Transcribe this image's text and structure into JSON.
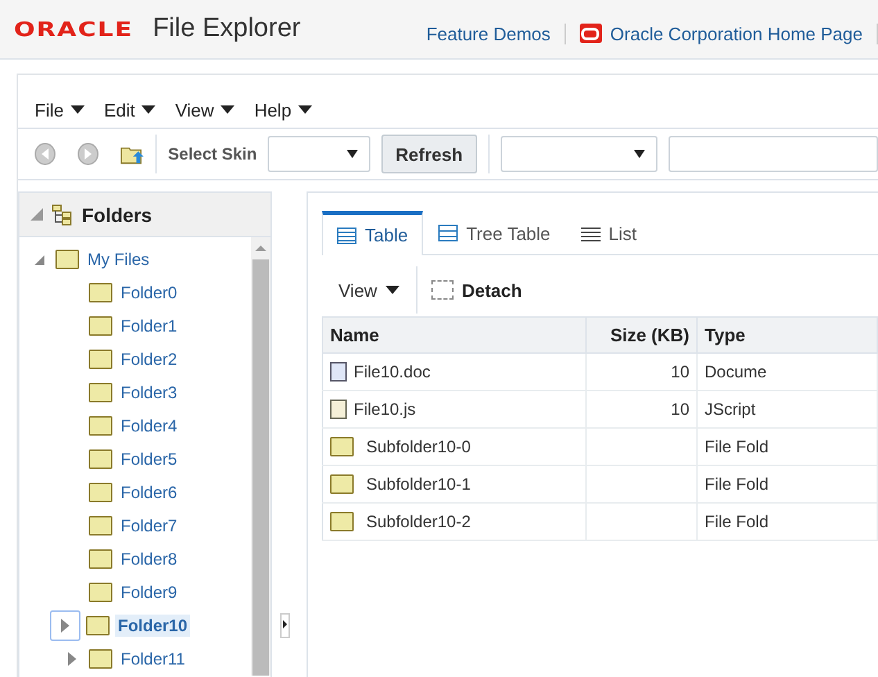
{
  "header": {
    "logo": "ORACLE",
    "title": "File Explorer",
    "links": [
      {
        "label": "Feature Demos",
        "icon": false
      },
      {
        "label": "Oracle Corporation Home Page",
        "icon": true
      }
    ]
  },
  "menus": [
    {
      "label": "File"
    },
    {
      "label": "Edit"
    },
    {
      "label": "View"
    },
    {
      "label": "Help"
    }
  ],
  "toolbar": {
    "skin_label": "Select Skin",
    "refresh": "Refresh"
  },
  "folders": {
    "title": "Folders",
    "expanded": true,
    "tree": [
      {
        "label": "My Files",
        "kind": "branch",
        "expanded": true,
        "selected": false,
        "children": [
          {
            "label": "Folder0",
            "kind": "leaf",
            "selected": false
          },
          {
            "label": "Folder1",
            "kind": "leaf",
            "selected": false
          },
          {
            "label": "Folder2",
            "kind": "leaf",
            "selected": false
          },
          {
            "label": "Folder3",
            "kind": "leaf",
            "selected": false
          },
          {
            "label": "Folder4",
            "kind": "leaf",
            "selected": false
          },
          {
            "label": "Folder5",
            "kind": "leaf",
            "selected": false
          },
          {
            "label": "Folder6",
            "kind": "leaf",
            "selected": false
          },
          {
            "label": "Folder7",
            "kind": "leaf",
            "selected": false
          },
          {
            "label": "Folder8",
            "kind": "leaf",
            "selected": false
          },
          {
            "label": "Folder9",
            "kind": "leaf",
            "selected": false
          },
          {
            "label": "Folder10",
            "kind": "branch",
            "expanded": false,
            "selected": true
          },
          {
            "label": "Folder11",
            "kind": "branch",
            "expanded": false,
            "selected": false
          }
        ]
      }
    ]
  },
  "tabs": [
    {
      "label": "Table",
      "kind": "table",
      "selected": true
    },
    {
      "label": "Tree Table",
      "kind": "treetable",
      "selected": false
    },
    {
      "label": "List",
      "kind": "list",
      "selected": false
    }
  ],
  "view_menu": "View",
  "detach": "Detach",
  "table": {
    "columns": [
      "Name",
      "Size (KB)",
      "Type"
    ],
    "rows": [
      {
        "kind": "doc",
        "name": "File10.doc",
        "size": "10",
        "type": "Docume"
      },
      {
        "kind": "script",
        "name": "File10.js",
        "size": "10",
        "type": "JScript"
      },
      {
        "kind": "folder",
        "name": "Subfolder10-0",
        "type": "File Fold"
      },
      {
        "kind": "folder",
        "name": "Subfolder10-1",
        "type": "File Fold"
      },
      {
        "kind": "folder",
        "name": "Subfolder10-2",
        "type": "File Fold"
      }
    ]
  }
}
